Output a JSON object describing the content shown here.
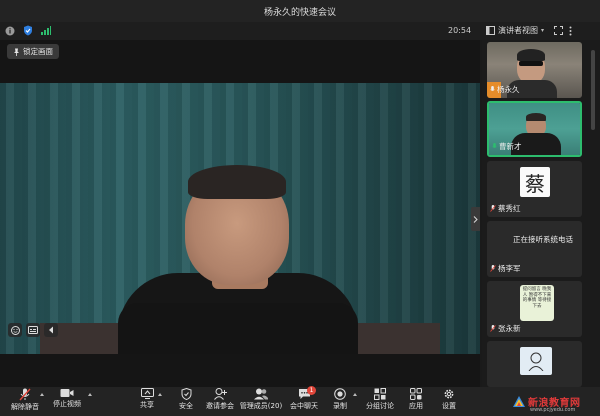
{
  "window": {
    "title": "杨永久的快速会议"
  },
  "status": {
    "time": "20:54",
    "speaker_view_label": "演讲者视图"
  },
  "main": {
    "lock_label": "锁定画面"
  },
  "participants": [
    {
      "name": "杨永久",
      "kind": "camera",
      "muted": false,
      "active": false
    },
    {
      "name": "曹新才",
      "kind": "camera",
      "muted": false,
      "active": true
    },
    {
      "name": "蔡秀红",
      "kind": "avatar",
      "avatar_char": "蔡",
      "muted": true,
      "active": false
    },
    {
      "name": "杨李军",
      "kind": "status",
      "status_text": "正在接听系统电话",
      "muted": true,
      "active": false
    },
    {
      "name": "张永新",
      "kind": "note",
      "note_text": "提问留言 晚我人 暂得不下来 的事情 等待接下去",
      "muted": true,
      "active": false
    },
    {
      "name": "",
      "kind": "partial",
      "muted": true,
      "active": false
    }
  ],
  "toolbar": {
    "mute": "解除静音",
    "video": "停止视频",
    "share": "共享",
    "security": "安全",
    "invite": "邀请参会",
    "manage": "管理成员(20)",
    "chat": "会中聊天",
    "chat_badge": "1",
    "record": "录制",
    "breakout": "分组讨论",
    "apps": "应用",
    "settings": "设置"
  },
  "watermark": {
    "text": "新浪教育网",
    "sub": "www.pcjyedu.com"
  },
  "colors": {
    "accent_green": "#2dbd6e",
    "badge_red": "#e0463a",
    "bg_dark": "#1a1a1a"
  }
}
